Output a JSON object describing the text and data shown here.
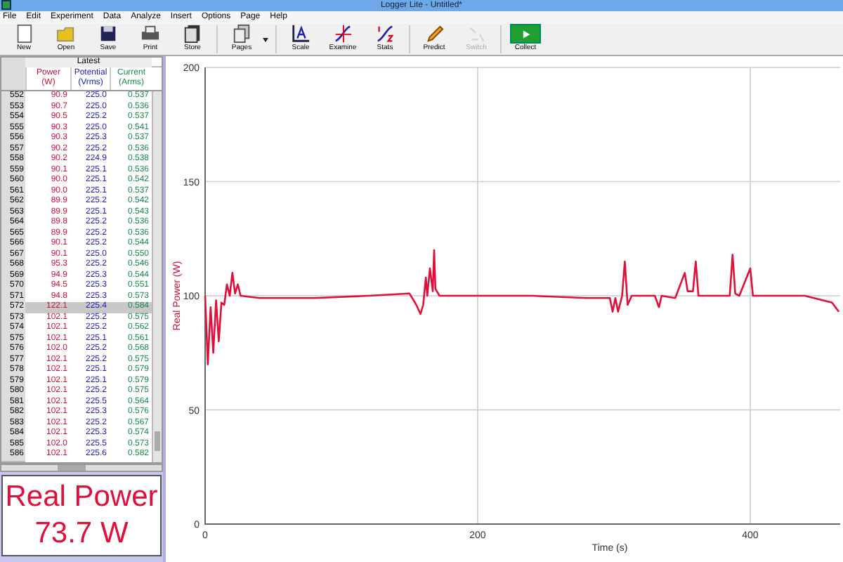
{
  "window": {
    "title": "Logger Lite - Untitled*"
  },
  "menu": [
    "File",
    "Edit",
    "Experiment",
    "Data",
    "Analyze",
    "Insert",
    "Options",
    "Page",
    "Help"
  ],
  "toolbar": [
    {
      "label": "New",
      "disabled": false,
      "dropdown": false
    },
    {
      "label": "Open",
      "disabled": false,
      "dropdown": false
    },
    {
      "label": "Save",
      "disabled": false,
      "dropdown": false
    },
    {
      "label": "Print",
      "disabled": false,
      "dropdown": false
    },
    {
      "label": "Store",
      "disabled": false,
      "dropdown": false
    },
    {
      "label": "Pages",
      "disabled": false,
      "dropdown": true
    },
    {
      "label": "Scale",
      "disabled": false,
      "dropdown": false
    },
    {
      "label": "Examine",
      "disabled": false,
      "dropdown": false
    },
    {
      "label": "Stats",
      "disabled": false,
      "dropdown": false
    },
    {
      "label": "Predict",
      "disabled": false,
      "dropdown": false
    },
    {
      "label": "Switch",
      "disabled": true,
      "dropdown": false
    }
  ],
  "collect_button": {
    "label": "Collect"
  },
  "table": {
    "group": "Latest",
    "columns": [
      {
        "label": "Power",
        "unit": "(W)",
        "color": "#d0103a"
      },
      {
        "label": "Potential",
        "unit": "(Vrms)",
        "color": "#2020c0"
      },
      {
        "label": "Current",
        "unit": "(Arms)",
        "color": "#1a8a4a"
      }
    ],
    "rows": [
      {
        "index": "552",
        "cells": [
          "90.9",
          "225.0",
          "0.537"
        ],
        "selected": false
      },
      {
        "index": "553",
        "cells": [
          "90.7",
          "225.0",
          "0.536"
        ],
        "selected": false
      },
      {
        "index": "554",
        "cells": [
          "90.5",
          "225.2",
          "0.537"
        ],
        "selected": false
      },
      {
        "index": "555",
        "cells": [
          "90.3",
          "225.0",
          "0.541"
        ],
        "selected": false
      },
      {
        "index": "556",
        "cells": [
          "90.3",
          "225.3",
          "0.537"
        ],
        "selected": false
      },
      {
        "index": "557",
        "cells": [
          "90.2",
          "225.2",
          "0.536"
        ],
        "selected": false
      },
      {
        "index": "558",
        "cells": [
          "90.2",
          "224.9",
          "0.538"
        ],
        "selected": false
      },
      {
        "index": "559",
        "cells": [
          "90.1",
          "225.1",
          "0.536"
        ],
        "selected": false
      },
      {
        "index": "560",
        "cells": [
          "90.0",
          "225.1",
          "0.542"
        ],
        "selected": false
      },
      {
        "index": "561",
        "cells": [
          "90.0",
          "225.1",
          "0.537"
        ],
        "selected": false
      },
      {
        "index": "562",
        "cells": [
          "89.9",
          "225.2",
          "0.542"
        ],
        "selected": false
      },
      {
        "index": "563",
        "cells": [
          "89.9",
          "225.1",
          "0.543"
        ],
        "selected": false
      },
      {
        "index": "564",
        "cells": [
          "89.8",
          "225.2",
          "0.536"
        ],
        "selected": false
      },
      {
        "index": "565",
        "cells": [
          "89.9",
          "225.2",
          "0.536"
        ],
        "selected": false
      },
      {
        "index": "566",
        "cells": [
          "90.1",
          "225.2",
          "0.544"
        ],
        "selected": false
      },
      {
        "index": "567",
        "cells": [
          "90.1",
          "225.0",
          "0.550"
        ],
        "selected": false
      },
      {
        "index": "568",
        "cells": [
          "95.3",
          "225.2",
          "0.546"
        ],
        "selected": false
      },
      {
        "index": "569",
        "cells": [
          "94.9",
          "225.3",
          "0.544"
        ],
        "selected": false
      },
      {
        "index": "570",
        "cells": [
          "94.5",
          "225.3",
          "0.551"
        ],
        "selected": false
      },
      {
        "index": "571",
        "cells": [
          "94.8",
          "225.3",
          "0.573"
        ],
        "selected": false
      },
      {
        "index": "572",
        "cells": [
          "122.1",
          "225.4",
          "0.584"
        ],
        "selected": true
      },
      {
        "index": "573",
        "cells": [
          "102.1",
          "225.2",
          "0.575"
        ],
        "selected": false
      },
      {
        "index": "574",
        "cells": [
          "102.1",
          "225.2",
          "0.562"
        ],
        "selected": false
      },
      {
        "index": "575",
        "cells": [
          "102.1",
          "225.1",
          "0.561"
        ],
        "selected": false
      },
      {
        "index": "576",
        "cells": [
          "102.0",
          "225.2",
          "0.568"
        ],
        "selected": false
      },
      {
        "index": "577",
        "cells": [
          "102.1",
          "225.2",
          "0.575"
        ],
        "selected": false
      },
      {
        "index": "578",
        "cells": [
          "102.1",
          "225.1",
          "0.579"
        ],
        "selected": false
      },
      {
        "index": "579",
        "cells": [
          "102.1",
          "225.1",
          "0.579"
        ],
        "selected": false
      },
      {
        "index": "580",
        "cells": [
          "102.1",
          "225.2",
          "0.575"
        ],
        "selected": false
      },
      {
        "index": "581",
        "cells": [
          "102.1",
          "225.5",
          "0.564"
        ],
        "selected": false
      },
      {
        "index": "582",
        "cells": [
          "102.1",
          "225.3",
          "0.576"
        ],
        "selected": false
      },
      {
        "index": "583",
        "cells": [
          "102.1",
          "225.2",
          "0.567"
        ],
        "selected": false
      },
      {
        "index": "584",
        "cells": [
          "102.1",
          "225.3",
          "0.574"
        ],
        "selected": false
      },
      {
        "index": "585",
        "cells": [
          "102.0",
          "225.5",
          "0.573"
        ],
        "selected": false
      },
      {
        "index": "586",
        "cells": [
          "102.1",
          "225.6",
          "0.582"
        ],
        "selected": false
      }
    ]
  },
  "meter": {
    "label": "Real Power",
    "reading": "73.7 W"
  },
  "graph": {
    "chart_data": {
      "type": "line",
      "xlabel": "Time (s)",
      "ylabel": "Real Power (W)",
      "x": [
        0,
        2,
        4,
        6,
        8,
        10,
        12,
        14,
        16,
        18,
        20,
        22,
        24,
        26,
        40,
        80,
        120,
        150,
        155,
        158,
        160,
        162,
        163,
        165,
        167,
        168,
        169,
        172,
        200,
        240,
        280,
        297,
        299,
        301,
        303,
        306,
        308,
        310,
        313,
        320,
        330,
        333,
        335,
        345,
        352,
        354,
        358,
        360,
        362,
        370,
        385,
        387,
        389,
        392,
        400,
        402,
        420,
        440,
        460,
        465
      ],
      "series": [
        {
          "color": "#e0103a",
          "values": [
            100,
            70,
            95,
            75,
            98,
            80,
            97,
            96,
            105,
            100,
            110,
            101,
            105,
            100,
            99,
            99,
            100,
            101,
            96,
            92,
            96,
            108,
            100,
            112,
            102,
            120,
            103,
            100,
            100,
            100,
            99,
            99,
            93,
            99,
            93,
            100,
            115,
            96,
            100,
            100,
            100,
            95,
            100,
            99,
            110,
            102,
            102,
            115,
            100,
            100,
            100,
            118,
            101,
            100,
            112,
            100,
            100,
            100,
            97,
            93
          ]
        }
      ],
      "grid": true,
      "xlim": [
        0,
        466
      ],
      "ylim": [
        0,
        200
      ],
      "xticks": [
        0,
        200,
        400
      ],
      "yticks": [
        0,
        50,
        100,
        150,
        200
      ]
    }
  }
}
